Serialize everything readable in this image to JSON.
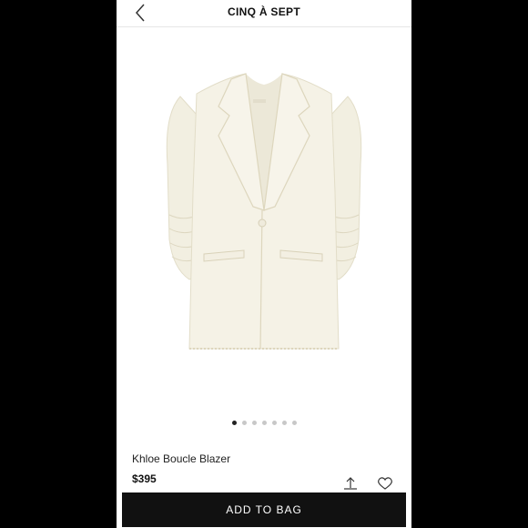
{
  "header": {
    "title": "CINQ À SEPT",
    "back_icon": "chevron-left-icon"
  },
  "gallery": {
    "image_count": 7,
    "active_index": 0
  },
  "product": {
    "name": "Khloe Boucle Blazer",
    "price": "$395"
  },
  "actions": {
    "share_icon": "share-icon",
    "favorite_icon": "heart-icon",
    "add_to_bag_label": "ADD TO BAG"
  },
  "colors": {
    "button_bg": "#111111",
    "garment": "#f4f1e4",
    "dot_active": "#222222",
    "dot_inactive": "#c8c8c8"
  }
}
